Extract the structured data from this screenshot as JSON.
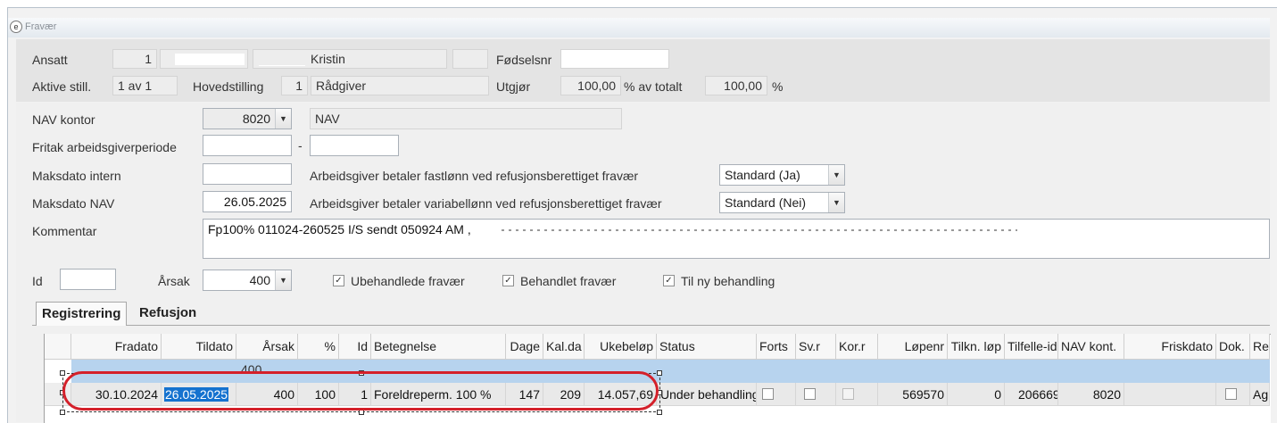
{
  "window": {
    "title": "Fravær",
    "title_icon": "app-icon"
  },
  "employee": {
    "ansatt_label": "Ansatt",
    "ansatt_nr": "1",
    "ansatt_name_visible": "Kristin",
    "fodselsnr_label": "Fødselsnr",
    "aktive_label": "Aktive still.",
    "aktive_value": "1 av 1",
    "hovedstilling_label": "Hovedstilling",
    "hovedstilling_nr": "1",
    "hovedstilling_value": "Rådgiver",
    "utgjor_label": "Utgjør",
    "utgjor_value": "100,00",
    "av_totalt_label": "% av totalt",
    "totalt_value": "100,00",
    "percent_sign": "%"
  },
  "form": {
    "nav_kontor_label": "NAV kontor",
    "nav_kontor_value": "8020",
    "nav_kontor_name": "NAV",
    "fritak_label": "Fritak arbeidsgiverperiode",
    "fritak_from": "",
    "fritak_dash": "-",
    "fritak_to": "",
    "maksdato_intern_label": "Maksdato intern",
    "maksdato_intern_value": "",
    "maksdato_nav_label": "Maksdato NAV",
    "maksdato_nav_value": "26.05.2025",
    "fastlonn_label": "Arbeidsgiver betaler fastlønn ved refusjonsberettiget fravær",
    "fastlonn_value": "Standard (Ja)",
    "variabel_label": "Arbeidsgiver betaler variabellønn ved refusjonsberettiget fravær",
    "variabel_value": "Standard (Nei)",
    "kommentar_label": "Kommentar",
    "kommentar_value": "Fp100% 011024-260525 I/S sendt 050924 AM  ,"
  },
  "filters": {
    "id_label": "Id",
    "id_value": "",
    "arsak_label": "Årsak",
    "arsak_value": "400",
    "ubehandlede_label": "Ubehandlede fravær",
    "ubehandlede_checked": "✓",
    "behandlet_label": "Behandlet fravær",
    "behandlet_checked": "✓",
    "ny_behandling_label": "Til ny behandling",
    "ny_behandling_checked": "✓"
  },
  "tabs": [
    {
      "label": "Registrering"
    },
    {
      "label": "Refusjon"
    }
  ],
  "grid": {
    "columns": [
      "Fradato",
      "Tildato",
      "Årsak",
      "%",
      "Id",
      "Betegnelse",
      "Dage",
      "Kal.da",
      "Ukebeløp",
      "Status",
      "Forts",
      "Sv.r",
      "Kor.r",
      "Løpenr",
      "Tilkn. løp",
      "Tilfelle-id",
      "NAV kont.",
      "Friskdato",
      "Dok.",
      "Re"
    ],
    "group_row": {
      "arsak": "400"
    },
    "rows": [
      {
        "fradato": "30.10.2024",
        "tildato": "26.05.2025",
        "arsak": "400",
        "prosent": "100",
        "id": "1",
        "betegnelse": "Foreldreperm. 100 %",
        "dager": "147",
        "kaldager": "209",
        "ukebelop": "14.057,69",
        "status": "Under behandling",
        "lopenr": "569570",
        "tilkn_lop": "0",
        "tilfelle_id": "206669",
        "nav_kont": "8020",
        "friskdato": "",
        "re": "Ag"
      }
    ]
  },
  "colors": {
    "highlight_ring": "#d4202a",
    "selection": "#1572cf",
    "group_row": "#b7d3ee"
  }
}
